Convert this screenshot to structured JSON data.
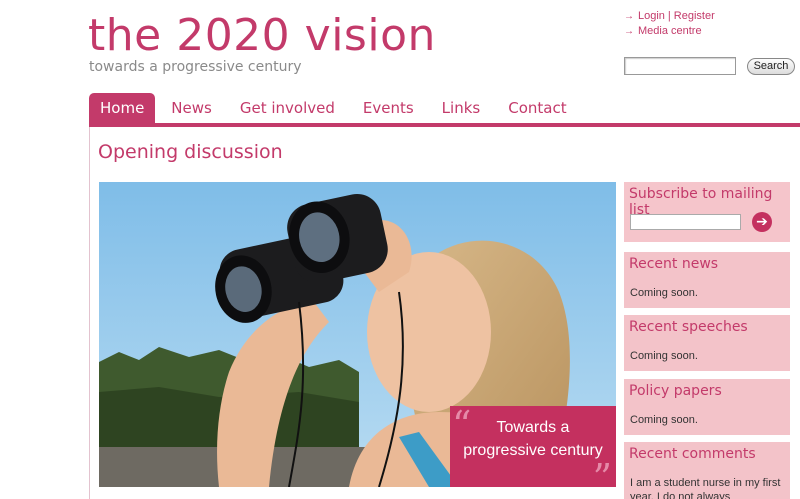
{
  "site": {
    "title": "the 2020 vision",
    "tagline": "towards a progressive century"
  },
  "utility": {
    "login": "Login",
    "separator": "|",
    "register": "Register",
    "media": "Media centre",
    "arrow_icon": "arrow-right-icon"
  },
  "search": {
    "value": "",
    "button": "Search"
  },
  "nav": {
    "tabs": [
      {
        "label": "Home",
        "active": true
      },
      {
        "label": "News"
      },
      {
        "label": "Get involved"
      },
      {
        "label": "Events"
      },
      {
        "label": "Links"
      },
      {
        "label": "Contact"
      }
    ]
  },
  "main": {
    "heading": "Opening discussion",
    "hero": {
      "quote_line1": "Towards a",
      "quote_line2": "progressive century",
      "open_quote": "“",
      "close_quote": "”"
    }
  },
  "sidebar": {
    "mailing": {
      "title": "Subscribe to mailing list",
      "input_value": "",
      "go_icon": "arrow-right-circle-icon",
      "go_symbol": "➔"
    },
    "boxes": [
      {
        "title": "Recent news",
        "body": "Coming soon."
      },
      {
        "title": "Recent speeches",
        "body": "Coming soon."
      },
      {
        "title": "Policy papers",
        "body": "Coming soon."
      },
      {
        "title": "Recent comments",
        "body": "I am a student nurse in my first year. I do not always"
      }
    ]
  },
  "colors": {
    "brand": "#c33a6a",
    "sidebar_bg": "#f3c3c9",
    "quote_bg": "#c4305f"
  }
}
